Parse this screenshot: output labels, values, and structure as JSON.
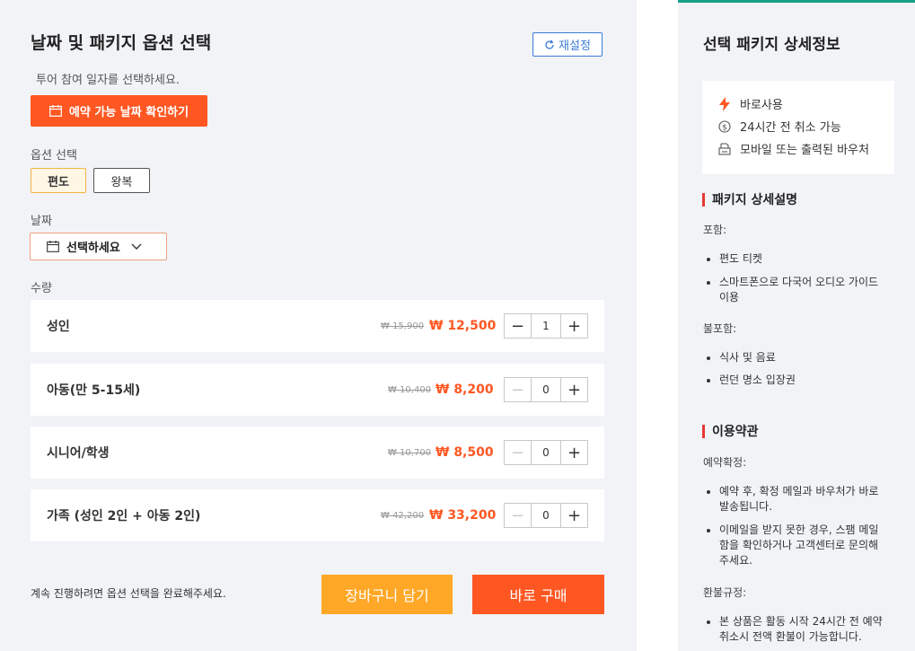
{
  "left": {
    "title": "날짜 및 패키지 옵션 선택",
    "reset_label": "재설정",
    "hint": "투어 참여 일자를 선택하세요.",
    "date_check_label": "예약 가능 날짜 확인하기",
    "options_label": "옵션 선택",
    "options": [
      "편도",
      "왕복"
    ],
    "selected_option": "편도",
    "date_label": "날짜",
    "date_value": "선택하세요",
    "qty_label": "수량",
    "quantities": [
      {
        "name": "성인",
        "old_price": "₩ 15,900",
        "new_price": "₩ 12,500",
        "qty": "1"
      },
      {
        "name": "아동(만 5-15세)",
        "old_price": "₩ 10,400",
        "new_price": "₩ 8,200",
        "qty": "0"
      },
      {
        "name": "시니어/학생",
        "old_price": "₩ 10,700",
        "new_price": "₩ 8,500",
        "qty": "0"
      },
      {
        "name": "가족 (성인 2인 + 아동 2인)",
        "old_price": "₩ 42,200",
        "new_price": "₩ 33,200",
        "qty": "0"
      }
    ],
    "bottom_msg": "계속 진행하려면 옵션 선택을 완료해주세요.",
    "cart_label": "장바구니 담기",
    "buy_label": "바로 구매"
  },
  "right": {
    "title": "선택 패키지 상세정보",
    "features": [
      {
        "icon": "lightning-icon",
        "label": "바로사용"
      },
      {
        "icon": "refund-coin-icon",
        "label": "24시간 전 취소 가능"
      },
      {
        "icon": "printer-icon",
        "label": "모바일 또는 출력된 바우처"
      }
    ],
    "package_heading": "패키지 상세설명",
    "include_label": "포함:",
    "includes": [
      "편도 티켓",
      "스마트폰으로 다국어 오디오 가이드 이용"
    ],
    "exclude_label": "불포함:",
    "excludes": [
      "식사 및 음료",
      "런던 명소 입장권"
    ],
    "terms_heading": "이용약관",
    "confirm_label": "예약확정:",
    "confirm_items": [
      "예약 후, 확정 메일과 바우처가 바로 발송됩니다.",
      "이메일을 받지 못한 경우, 스팸 메일함을 확인하거나 고객센터로 문의해주세요."
    ],
    "refund_label": "환불규정:",
    "refund_items": [
      "본 상품은 활동 시작 24시간 전 예약 취소시 전액 환불이 가능합니다."
    ]
  },
  "colors": {
    "accent": "#ff5722",
    "secondary": "#ffa726",
    "link": "#3a7bd5",
    "bg": "#f1f3f7"
  }
}
